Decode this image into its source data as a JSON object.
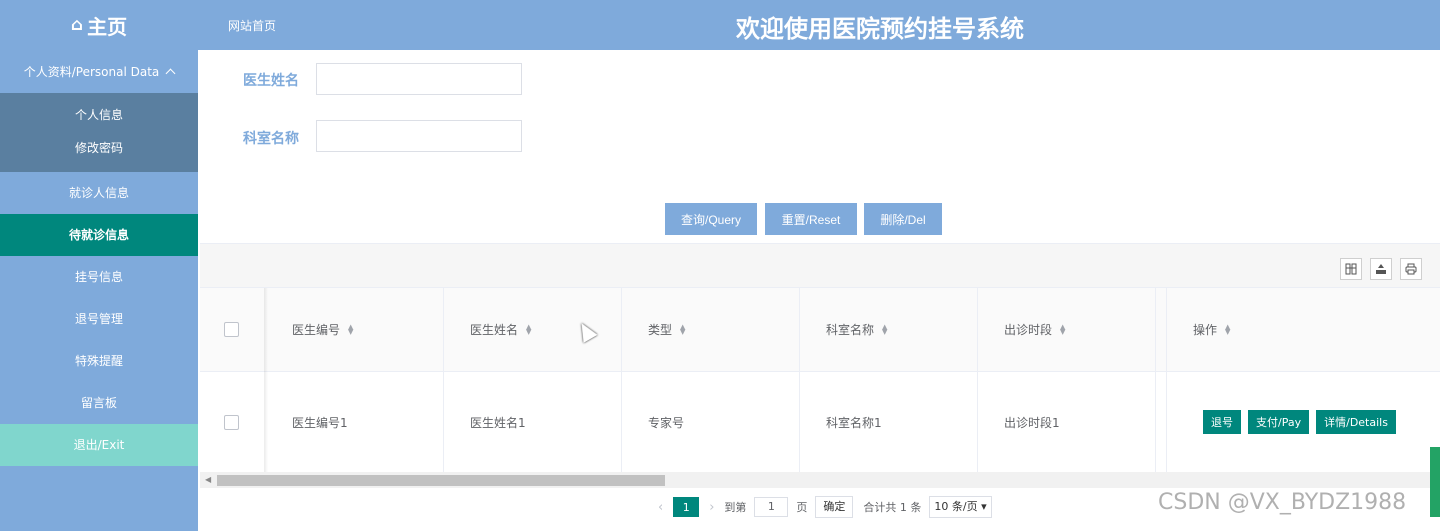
{
  "header": {
    "brand": "主页",
    "breadcrumb": "网站首页",
    "title": "欢迎使用医院预约挂号系统"
  },
  "sidebar": {
    "group": "个人资料/Personal Data",
    "sub_items": [
      "个人信息",
      "修改密码"
    ],
    "items": [
      "就诊人信息",
      "待就诊信息",
      "挂号信息",
      "退号管理",
      "特殊提醒",
      "留言板"
    ],
    "exit": "退出/Exit"
  },
  "search": {
    "doctor_name_label": "医生姓名",
    "doctor_name_value": "",
    "dept_name_label": "科室名称",
    "dept_name_value": "",
    "query_button": "查询/Query",
    "reset_button": "重置/Reset",
    "delete_button": "删除/Del"
  },
  "table": {
    "columns": [
      "医生编号",
      "医生姓名",
      "类型",
      "科室名称",
      "出诊时段",
      "操作"
    ],
    "rows": [
      {
        "doctor_id": "医生编号1",
        "doctor_name": "医生姓名1",
        "type": "专家号",
        "dept": "科室名称1",
        "period": "出诊时段1"
      }
    ],
    "row_actions": [
      "退号",
      "支付/Pay",
      "详情/Details"
    ]
  },
  "pagination": {
    "current_page": "1",
    "goto_label": "到第",
    "goto_value": "1",
    "page_unit": "页",
    "confirm": "确定",
    "total": "合计共 1 条",
    "page_size": "10 条/页"
  },
  "watermark": "CSDN @VX_BYDZ1988",
  "colors": {
    "primary": "#7faadb",
    "active": "#00877d",
    "sub_menu": "#5a7fa0",
    "exit": "#80d6cd"
  }
}
